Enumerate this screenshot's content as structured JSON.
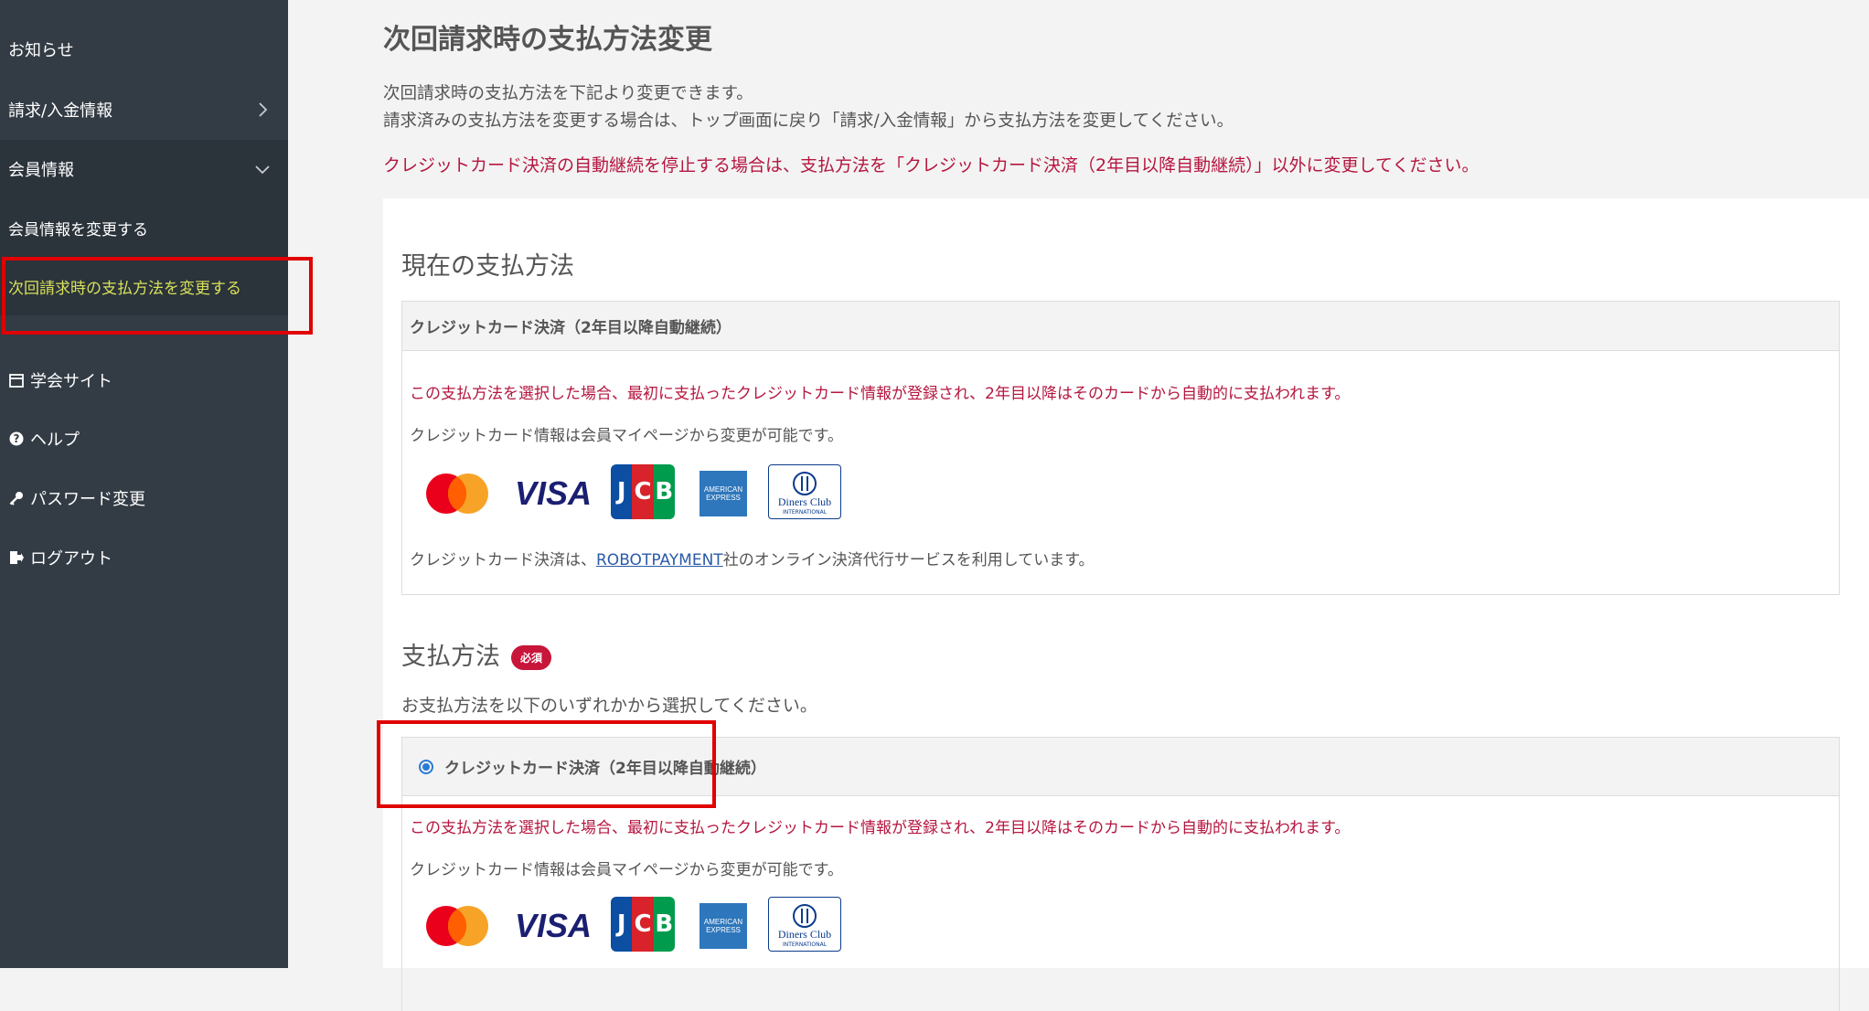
{
  "sidebar": {
    "items": [
      {
        "label": "お知らせ"
      },
      {
        "label": "請求/入金情報"
      },
      {
        "label": "会員情報"
      },
      {
        "label": "会員情報を変更する"
      },
      {
        "label": "次回請求時の支払方法を変更する"
      },
      {
        "label": "学会サイト",
        "icon": "calendar-icon"
      },
      {
        "label": "ヘルプ",
        "icon": "question-circle-icon"
      },
      {
        "label": "パスワード変更",
        "icon": "key-icon"
      },
      {
        "label": "ログアウト",
        "icon": "logout-icon"
      }
    ],
    "active_color": "#d7e05a",
    "bg_color": "#333c45"
  },
  "page": {
    "title": "次回請求時の支払方法変更",
    "intro_lines": [
      "次回請求時の支払方法を下記より変更できます。",
      "請求済みの支払方法を変更する場合は、トップ画面に戻り「請求/入金情報」から支払方法を変更してください。"
    ],
    "warning": "クレジットカード決済の自動継続を停止する場合は、支払方法を「クレジットカード決済（2年目以降自動継続）」以外に変更してください。"
  },
  "current_method": {
    "heading": "現在の支払方法",
    "name": "クレジットカード決済（2年目以降自動継続）",
    "note_red": "この支払方法を選択した場合、最初に支払ったクレジットカード情報が登録され、2年目以降はそのカードから自動的に支払われます。",
    "note_grey": "クレジットカード情報は会員マイページから変更が可能です。",
    "provider_prefix": "クレジットカード決済は、",
    "provider_link": "ROBOTPAYMENT",
    "provider_suffix": "社のオンライン決済代行サービスを利用しています。"
  },
  "payment_select": {
    "heading": "支払方法",
    "required_badge": "必須",
    "instruction": "お支払方法を以下のいずれかから選択してください。",
    "option_label": "クレジットカード決済（2年目以降自動継続）",
    "option_selected": true,
    "note_red": "この支払方法を選択した場合、最初に支払ったクレジットカード情報が登録され、2年目以降はそのカードから自動的に支払われます。",
    "note_grey": "クレジットカード情報は会員マイページから変更が可能です。"
  },
  "card_logos": {
    "visa": "VISA",
    "jcb": "JCB",
    "amex_line1": "AMERICAN",
    "amex_line2": "EXPRESS",
    "diners_line1": "Diners Club",
    "diners_line2": "INTERNATIONAL"
  },
  "colors": {
    "warning_red": "#b5163f",
    "highlight_red": "#e00000",
    "link_blue": "#2a5ba8"
  }
}
